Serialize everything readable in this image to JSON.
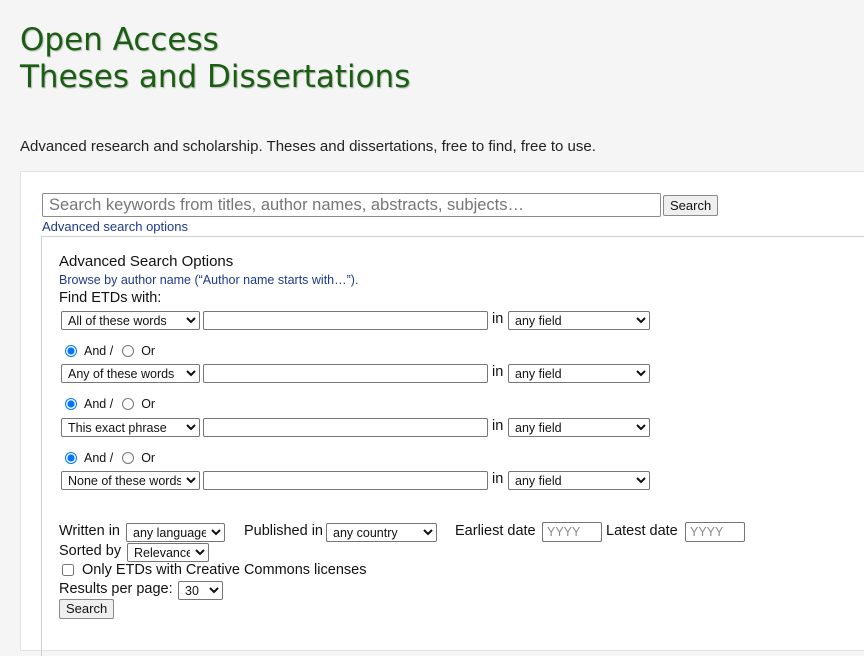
{
  "header": {
    "title_line1": "Open Access",
    "title_line2": "Theses and Dissertations",
    "tagline": "Advanced research and scholarship. Theses and dissertations, free to find, free to use."
  },
  "search": {
    "placeholder": "Search keywords from titles, author names, abstracts, subjects…",
    "button_label": "Search",
    "advanced_link": "Advanced search options"
  },
  "advanced": {
    "heading": "Advanced Search Options",
    "browse_link": "Browse by author name (“Author name starts with…”).",
    "find_label": "Find ETDs with:",
    "in_label": "in",
    "and_label": "And /",
    "or_label": "Or",
    "field_value": "any field",
    "rows": [
      {
        "match": "All of these words"
      },
      {
        "match": "Any of these words"
      },
      {
        "match": "This exact phrase"
      },
      {
        "match": "None of these words"
      }
    ],
    "written_in_label": "Written in",
    "language_value": "any language",
    "published_in_label": "Published in",
    "country_value": "any country",
    "earliest_label": "Earliest date",
    "latest_label": "Latest date",
    "date_placeholder": "YYYY",
    "sorted_by_label": "Sorted by",
    "sort_value": "Relevance",
    "cc_label": "Only ETDs with Creative Commons licenses",
    "per_page_label": "Results per page:",
    "per_page_value": "30",
    "search_button": "Search"
  },
  "colors": {
    "title_green": "#1a5e12",
    "link_blue": "#1d3a8a",
    "page_bg": "#f5f5f5"
  }
}
